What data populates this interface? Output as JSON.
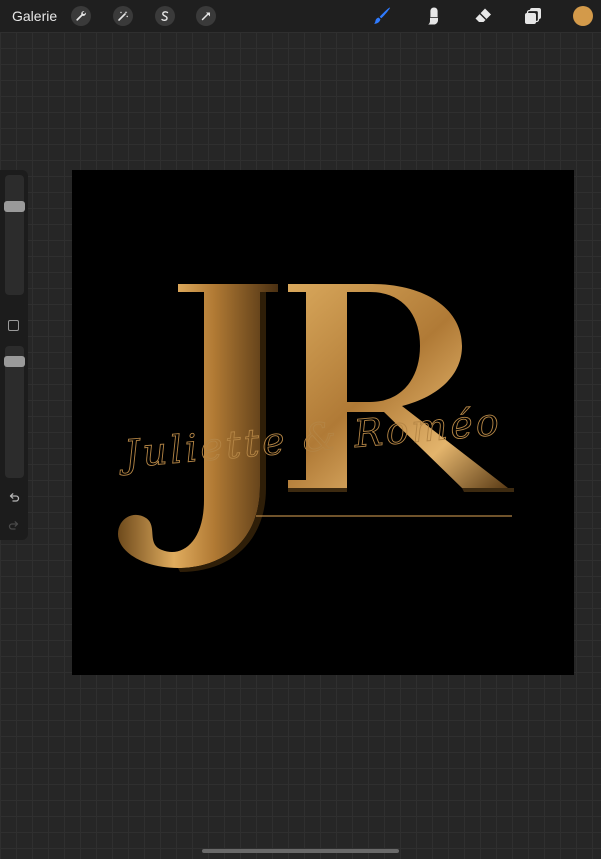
{
  "toolbar": {
    "gallery_label": "Galerie",
    "left_tools": [
      "wrench-icon",
      "magic-wand-icon",
      "selection-icon",
      "transform-icon"
    ],
    "right_tools": [
      "brush-icon",
      "smudge-icon",
      "eraser-icon",
      "layers-icon"
    ],
    "active_tool": "brush-icon",
    "active_color": "#d39a4a",
    "accent": "#2f7bff"
  },
  "sidebar": {
    "brush_size": 0.76,
    "opacity": 0.92,
    "undo_icon": "undo-icon",
    "redo_icon": "redo-icon"
  },
  "canvas": {
    "background": "#000000",
    "monogram": "JR",
    "script_text": "Juliette & Roméo",
    "gold": "#c8913e"
  }
}
